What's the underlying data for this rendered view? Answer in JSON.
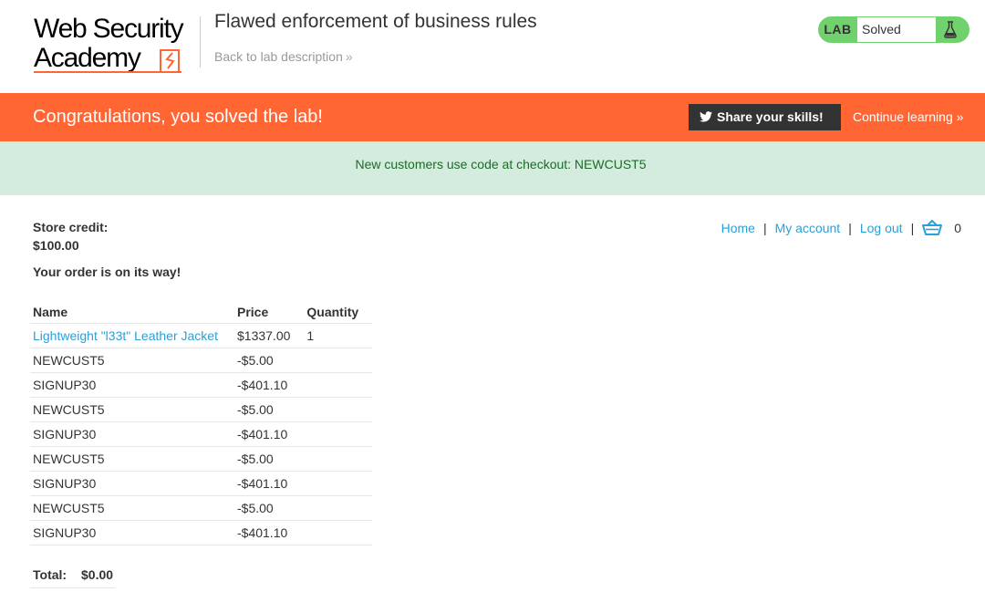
{
  "header": {
    "logo_line1": "Web Security",
    "logo_line2": "Academy",
    "lab_title": "Flawed enforcement of business rules",
    "back_link": "Back to lab description",
    "lab_tag": "LAB",
    "lab_state": "Solved"
  },
  "banner": {
    "message": "Congratulations, you solved the lab!",
    "share_label": "Share your skills!",
    "continue_label": "Continue learning"
  },
  "notice": {
    "text": "New customers use code at checkout: NEWCUST5"
  },
  "account": {
    "credit_label": "Store credit:",
    "credit_value": "$100.00",
    "order_message": "Your order is on its way!"
  },
  "nav": {
    "home": "Home",
    "separator": "|",
    "my_account": "My account",
    "log_out": "Log out",
    "cart_count": "0"
  },
  "order_table": {
    "headers": [
      "Name",
      "Price",
      "Quantity"
    ],
    "rows": [
      {
        "name": "Lightweight \"l33t\" Leather Jacket",
        "price": "$1337.00",
        "quantity": "1",
        "link": true
      },
      {
        "name": "NEWCUST5",
        "price": "-$5.00",
        "quantity": ""
      },
      {
        "name": "SIGNUP30",
        "price": "-$401.10",
        "quantity": ""
      },
      {
        "name": "NEWCUST5",
        "price": "-$5.00",
        "quantity": ""
      },
      {
        "name": "SIGNUP30",
        "price": "-$401.10",
        "quantity": ""
      },
      {
        "name": "NEWCUST5",
        "price": "-$5.00",
        "quantity": ""
      },
      {
        "name": "SIGNUP30",
        "price": "-$401.10",
        "quantity": ""
      },
      {
        "name": "NEWCUST5",
        "price": "-$5.00",
        "quantity": ""
      },
      {
        "name": "SIGNUP30",
        "price": "-$401.10",
        "quantity": ""
      }
    ]
  },
  "total": {
    "label": "Total:",
    "value": "$0.00"
  },
  "colors": {
    "brand_orange": "#ff6633",
    "solved_green": "#70d16d",
    "link_blue": "#29a1d8",
    "notice_bg": "#d3ecdd",
    "notice_text": "#1d6b29"
  },
  "icons": [
    "academy-bolt-icon",
    "chevron-double-right-icon",
    "flask-icon",
    "twitter-icon",
    "cart-icon"
  ]
}
